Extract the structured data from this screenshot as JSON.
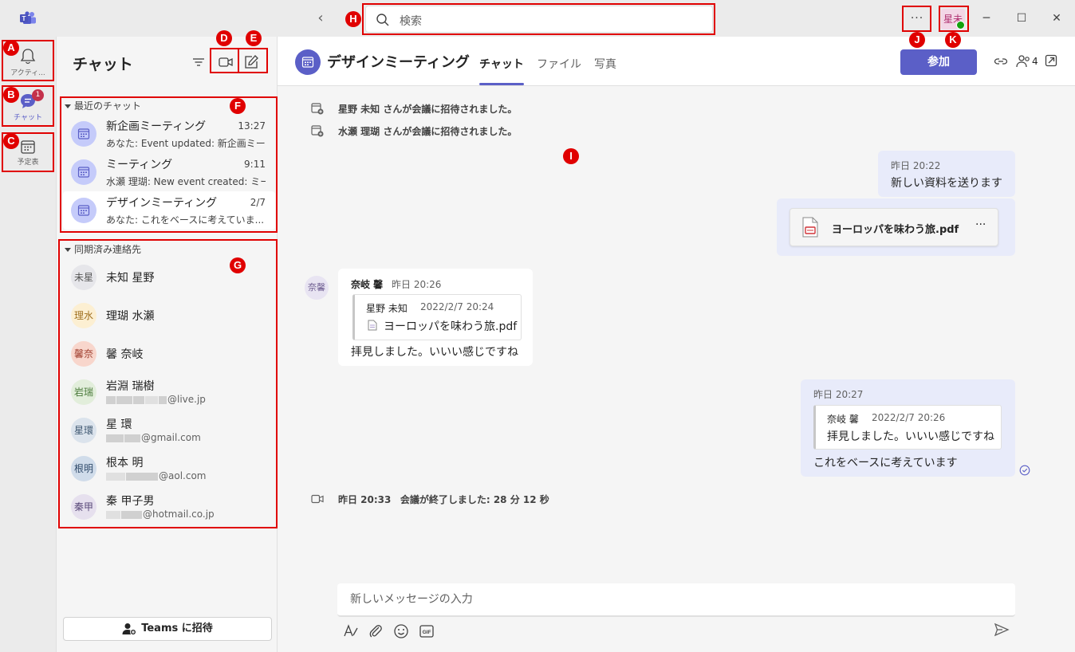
{
  "titlebar": {
    "search_placeholder": "検索",
    "more_label": "···",
    "me_initials": "星未"
  },
  "rail": {
    "items": [
      {
        "label": "アクティ...",
        "icon": "bell-icon"
      },
      {
        "label": "チャット",
        "icon": "chat-icon",
        "badge": "1"
      },
      {
        "label": "予定表",
        "icon": "calendar-icon"
      }
    ]
  },
  "chatlist": {
    "title": "チャット",
    "recent_label": "最近のチャット",
    "recent": [
      {
        "name": "新企画ミーティング",
        "time": "13:27",
        "preview": "あなた: Event updated: 新企画ミー..."
      },
      {
        "name": "ミーティング",
        "time": "9:11",
        "preview": "水瀬 理瑚: New event created: ミー..."
      },
      {
        "name": "デザインミーティング",
        "time": "2/7",
        "preview": "あなた: これをベースに考えていま..."
      }
    ],
    "contacts_label": "同期済み連絡先",
    "contacts": [
      {
        "initials": "未星",
        "name": "未知 星野",
        "email": ""
      },
      {
        "initials": "理水",
        "name": "理瑚 水瀬",
        "email": ""
      },
      {
        "initials": "馨奈",
        "name": "馨 奈岐",
        "email": ""
      },
      {
        "initials": "岩瑞",
        "name": "岩淵 瑞樹",
        "email": "@live.jp"
      },
      {
        "initials": "星環",
        "name": "星 環",
        "email": "@gmail.com"
      },
      {
        "initials": "根明",
        "name": "根本 明",
        "email": "@aol.com"
      },
      {
        "initials": "秦甲",
        "name": "秦 甲子男",
        "email": "@hotmail.co.jp"
      }
    ],
    "invite_label": "Teams に招待"
  },
  "main": {
    "title": "デザインミーティング",
    "tabs": [
      "チャット",
      "ファイル",
      "写真"
    ],
    "join_label": "参加",
    "participant_count": "4",
    "system_messages": [
      {
        "name": "星野 未知",
        "text": " さんが会議に招待されました。"
      },
      {
        "name": "水瀬 理瑚",
        "text": " さんが会議に招待されました。"
      }
    ],
    "msg1": {
      "time": "昨日 20:22",
      "text": "新しい資料を送ります"
    },
    "file": {
      "name": "ヨーロッパを味わう旅.pdf",
      "more": "···"
    },
    "msg2": {
      "avatar": "奈馨",
      "sender": "奈岐 馨",
      "time": "昨日 20:26",
      "quote_sender": "星野 未知",
      "quote_time": "2022/2/7 20:24",
      "quote_file": "ヨーロッパを味わう旅.pdf",
      "text": "拝見しました。いいい感じですね"
    },
    "msg3": {
      "time": "昨日 20:27",
      "quote_sender": "奈岐 馨",
      "quote_time": "2022/2/7 20:26",
      "quote_text": "拝見しました。いいい感じですね",
      "text": "これをベースに考えています"
    },
    "meeting_end": {
      "time": "昨日 20:33",
      "text": "会議が終了しました: 28 分 12 秒"
    },
    "composer_placeholder": "新しいメッセージの入力"
  },
  "annotations": [
    "A",
    "B",
    "C",
    "D",
    "E",
    "F",
    "G",
    "H",
    "I",
    "J",
    "K"
  ],
  "colors": {
    "accent": "#5b5fc7",
    "annotation": "#e00000",
    "presence": "#13a10e",
    "badge": "#c4314b"
  }
}
